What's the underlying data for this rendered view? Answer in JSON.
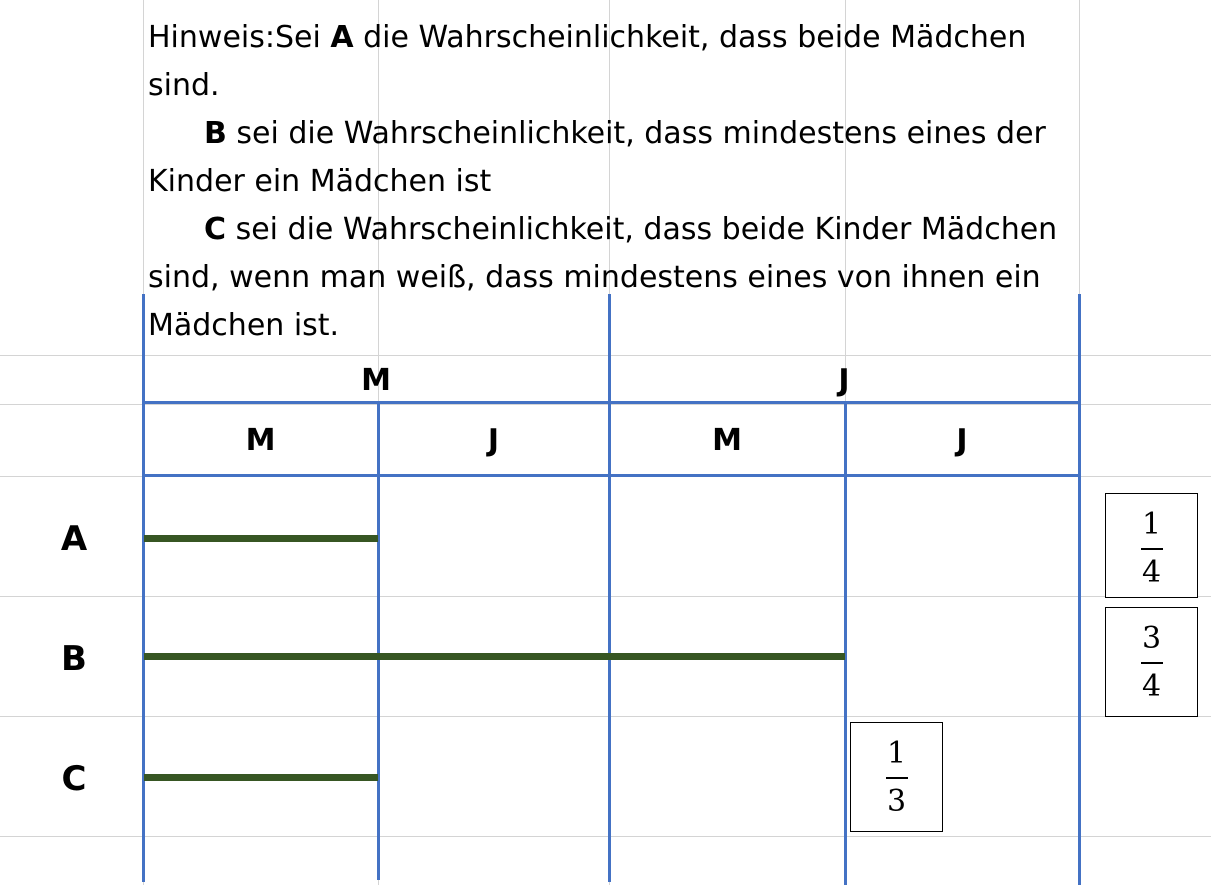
{
  "hint": {
    "line1_prefix": "Hinweis:Sei ",
    "line1_bold": "A",
    "line1_suffix": " die Wahrscheinlichkeit, dass beide Mädchen",
    "line2": "sind.",
    "line3_bold": "B",
    "line3_suffix": " sei die Wahrscheinlichkeit, dass mindestens eines der",
    "line4": "Kinder ein Mädchen ist",
    "line5_bold": "C",
    "line5_suffix": " sei die Wahrscheinlichkeit, dass beide Kinder Mädchen",
    "line6": "sind, wenn man weiß,  dass mindestens eines von ihnen ein",
    "line7": "Mädchen ist."
  },
  "table": {
    "top_headers": [
      "M",
      "J"
    ],
    "sub_headers": [
      "M",
      "J",
      "M",
      "J"
    ],
    "rows": [
      {
        "label": "A",
        "covered_columns": 1
      },
      {
        "label": "B",
        "covered_columns": 3
      },
      {
        "label": "C",
        "covered_columns": 1
      }
    ]
  },
  "fractions": {
    "a": {
      "numerator": "1",
      "denominator": "4"
    },
    "b": {
      "numerator": "3",
      "denominator": "4"
    },
    "c": {
      "numerator": "1",
      "denominator": "3"
    }
  },
  "colors": {
    "table_lines": "#4472c4",
    "bars": "#375623",
    "gridlines": "#d4d4d4"
  }
}
